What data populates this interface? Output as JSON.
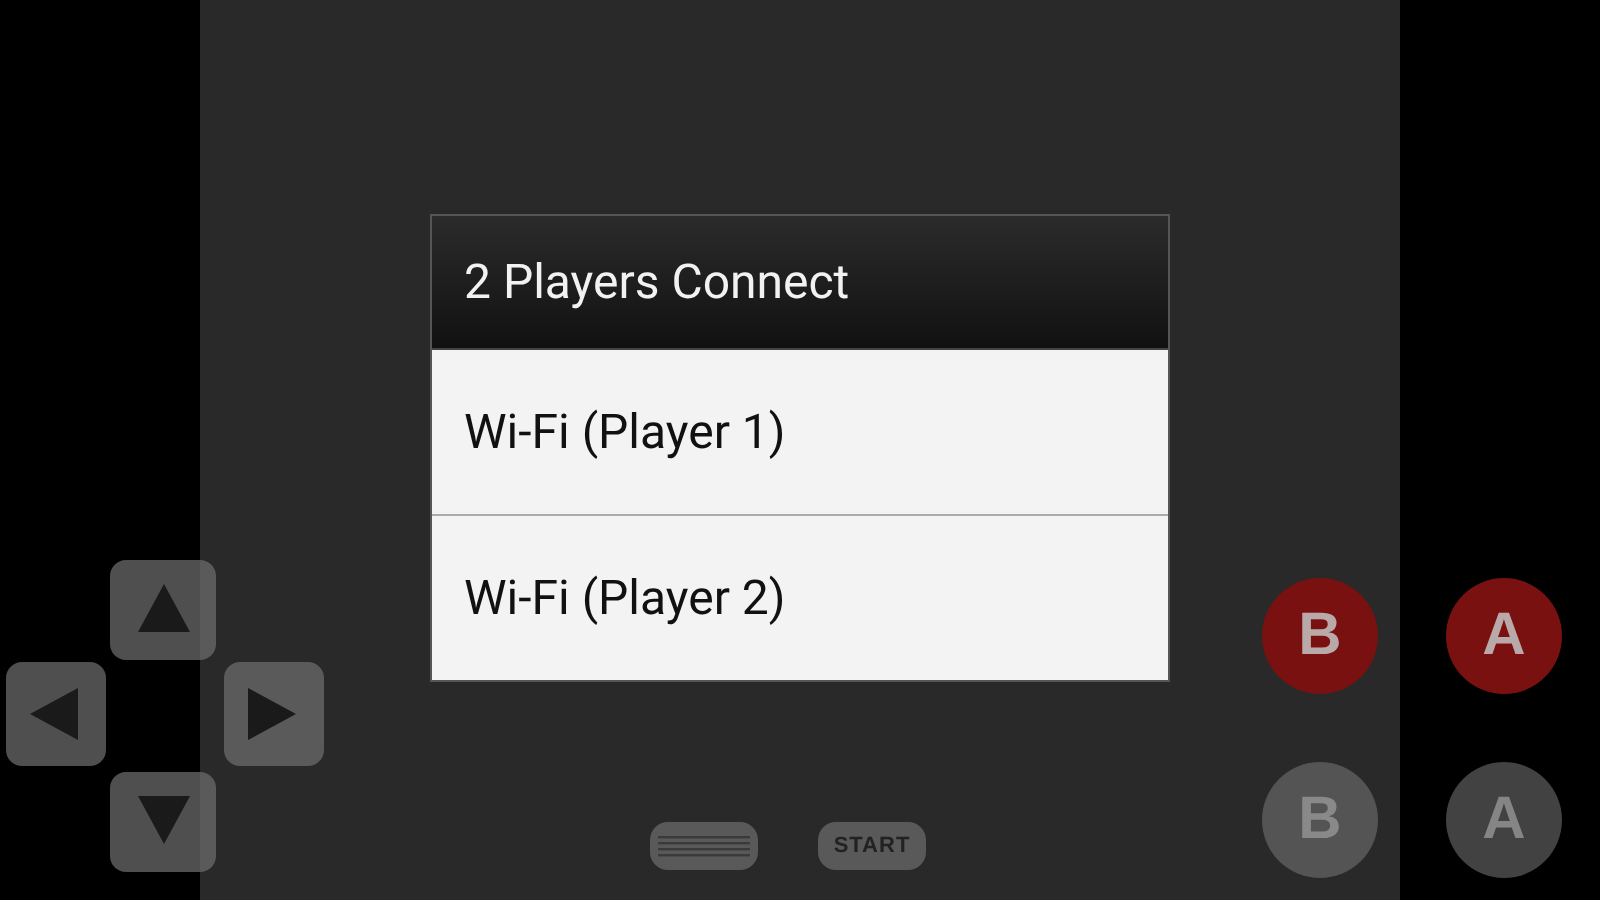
{
  "dialog": {
    "title": "2 Players Connect",
    "options": [
      {
        "label": "Wi-Fi (Player 1)"
      },
      {
        "label": "Wi-Fi (Player 2)"
      }
    ]
  },
  "face_buttons": [
    {
      "label": "B",
      "kind": "solid"
    },
    {
      "label": "A",
      "kind": "solid"
    },
    {
      "label": "B",
      "kind": "faded"
    },
    {
      "label": "A",
      "kind": "faded"
    }
  ],
  "start_button": {
    "label": "START"
  }
}
